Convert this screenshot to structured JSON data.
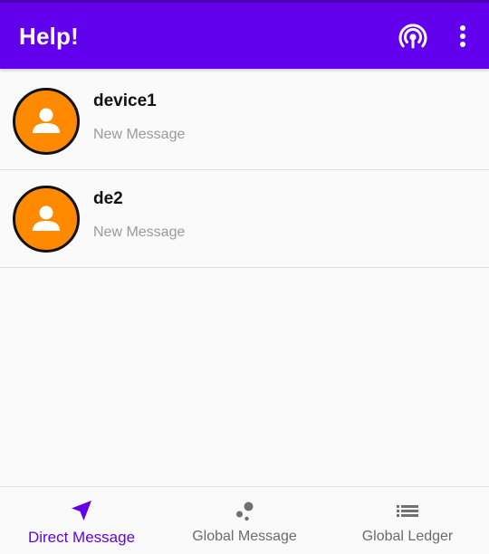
{
  "app_bar": {
    "title": "Help!",
    "background": "#6200ee",
    "actions": [
      {
        "icon": "broadcast-icon"
      },
      {
        "icon": "more-vert-icon"
      }
    ]
  },
  "conversations": [
    {
      "name": "device1",
      "subtitle": "New Message",
      "avatar_icon": "person-icon",
      "avatar_color": "#ff8a00"
    },
    {
      "name": "de2",
      "subtitle": "New Message",
      "avatar_icon": "person-icon",
      "avatar_color": "#ff8a00"
    }
  ],
  "bottom_nav": {
    "accent": "#6200ee",
    "items": [
      {
        "label": "Direct Message",
        "icon": "send-icon",
        "active": true
      },
      {
        "label": "Global Message",
        "icon": "bubbles-icon",
        "active": false
      },
      {
        "label": "Global Ledger",
        "icon": "list-icon",
        "active": false
      }
    ]
  }
}
